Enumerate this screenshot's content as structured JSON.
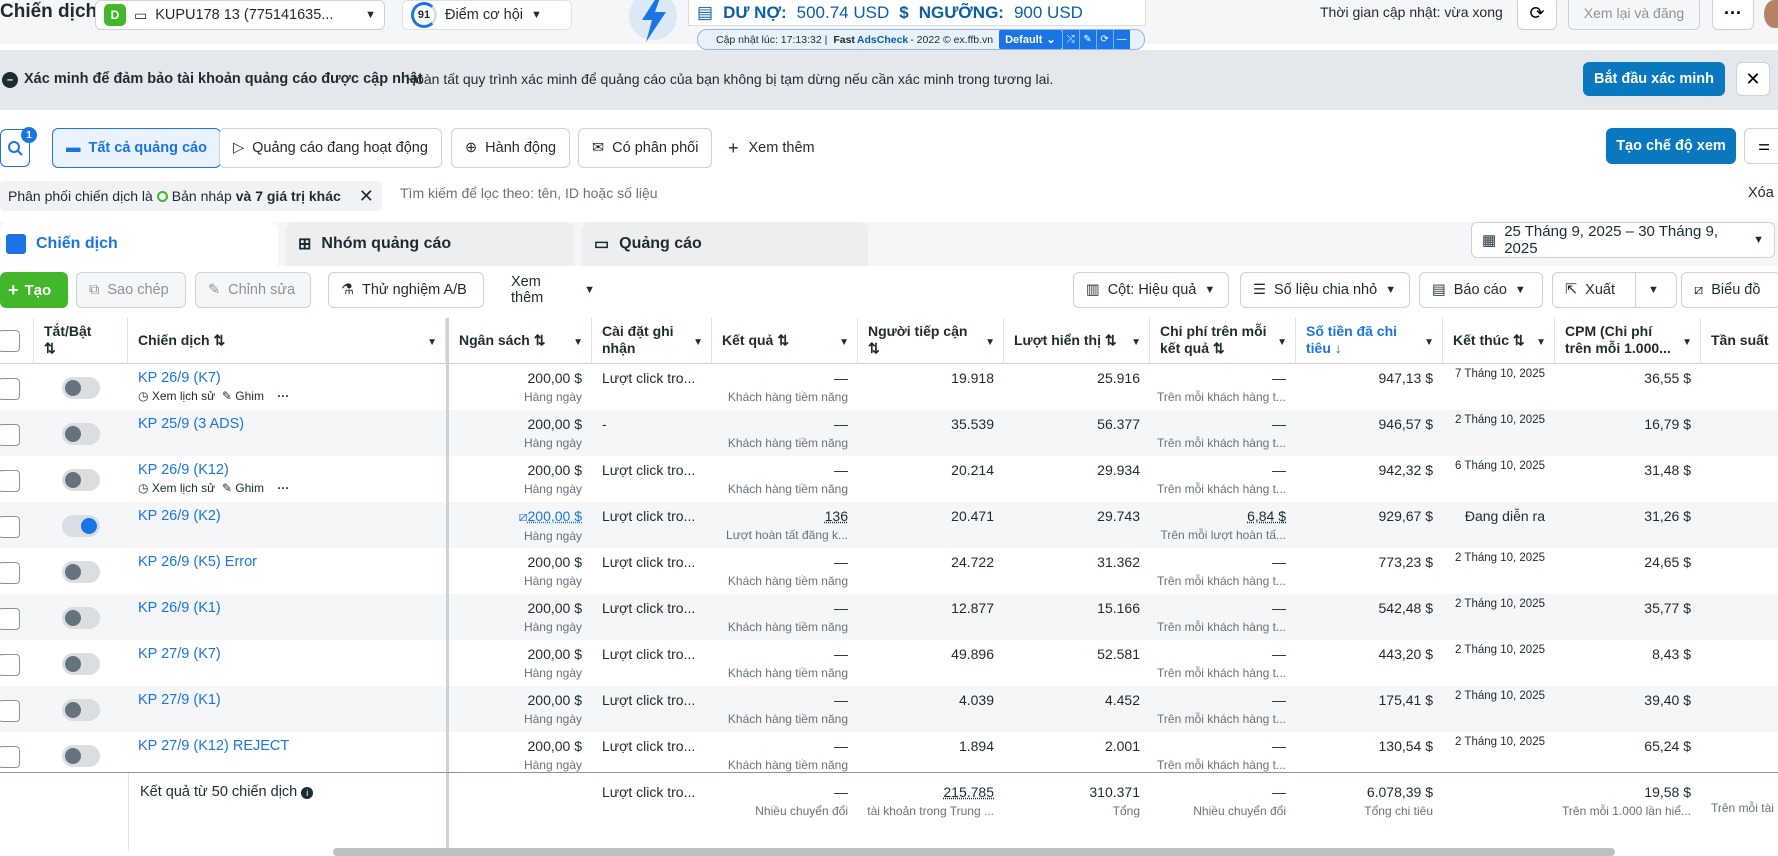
{
  "header": {
    "page_title": "Chiến dịch",
    "account_badge": "D",
    "account_name": "KUPU178 13 (775141635...",
    "opportunity_score": "91",
    "opportunity_label": "Điểm cơ hội",
    "debt_label": "DƯ NỢ:",
    "debt_value": "500.74 USD",
    "threshold_label": "NGƯỠNG:",
    "threshold_value": "900 USD",
    "update_strip": {
      "time_text": "Cập nhật lúc: 17:13:32 |",
      "fast": "Fast",
      "adscheck": "AdsCheck",
      "suffix": "- 2022 © ex.ffb.vn",
      "profile": "Default"
    },
    "update_status": "Thời gian cập nhật: vừa xong",
    "review_publish": "Xem lại và đăng",
    "more": "···"
  },
  "banner": {
    "title": "Xác minh để đảm bảo tài khoản quảng cáo được cập nhật",
    "text": "Hoàn tất quy trình xác minh để quảng cáo của bạn không bị tạm dừng nếu cần xác minh trong tương lai.",
    "verify_button": "Bắt đầu xác minh"
  },
  "filters": {
    "search_count": "1",
    "pills": [
      "Tất cả quảng cáo",
      "Quảng cáo đang hoạt động",
      "Hành động",
      "Có phân phối"
    ],
    "more": "Xem thêm",
    "create_view": "Tạo chế độ xem",
    "chip_prefix": "Phân phối chiến dịch là",
    "chip_value": "Bản nháp",
    "chip_more": "và 7 giá trị khác",
    "search_placeholder": "Tìm kiếm để lọc theo: tên, ID hoặc số liệu",
    "clear": "Xóa"
  },
  "tabs": {
    "campaigns": "Chiến dịch",
    "adsets": "Nhóm quảng cáo",
    "ads": "Quảng cáo",
    "date_range": "25 Tháng 9, 2025 – 30 Tháng 9, 2025"
  },
  "toolbar": {
    "create": "Tạo",
    "copy": "Sao chép",
    "edit": "Chỉnh sửa",
    "ab_test": "Thử nghiệm A/B",
    "more": "Xem thêm",
    "columns": "Cột: Hiệu quả",
    "breakdown": "Số liệu chia nhỏ",
    "reports": "Báo cáo",
    "export": "Xuất",
    "charts": "Biểu đồ"
  },
  "columns": {
    "toggle": "Tắt/Bật",
    "campaign": "Chiến dịch",
    "budget": "Ngân sách",
    "attribution": "Cài đặt ghi nhận",
    "results": "Kết quả",
    "reach": "Người tiếp cận",
    "impressions": "Lượt hiển thị",
    "cost_per_result": "Chi phí trên mỗi kết quả",
    "amount_spent": "Số tiền đã chi tiêu",
    "ends": "Kết thúc",
    "cpm": "CPM (Chi phí trên mỗi 1.000...",
    "frequency": "Tần suất"
  },
  "row_tools": {
    "history": "Xem lịch sử",
    "pin": "Ghim",
    "more": "···"
  },
  "rows": [
    {
      "name": "KP 26/9 (K7)",
      "on": false,
      "tools": true,
      "budget": "200,00 $",
      "budget_sub": "Hàng ngày",
      "attr": "Lượt click tro...",
      "result": "—",
      "result_sub": "Khách hàng tiềm năng",
      "reach": "19.918",
      "impr": "25.916",
      "cpr": "—",
      "cpr_sub": "Trên mỗi khách hàng t...",
      "spent": "947,13 $",
      "ends": "7 Tháng 10, 2025",
      "cpm": "36,55 $"
    },
    {
      "name": "KP 25/9 (3 ADS)",
      "on": false,
      "tools": false,
      "budget": "200,00 $",
      "budget_sub": "Hàng ngày",
      "attr": "-",
      "result": "—",
      "result_sub": "Khách hàng tiềm năng",
      "reach": "35.539",
      "impr": "56.377",
      "cpr": "—",
      "cpr_sub": "Trên mỗi khách hàng t...",
      "spent": "946,57 $",
      "ends": "2 Tháng 10, 2025",
      "cpm": "16,79 $"
    },
    {
      "name": "KP 26/9 (K12)",
      "on": false,
      "tools": true,
      "budget": "200,00 $",
      "budget_sub": "Hàng ngày",
      "attr": "Lượt click tro...",
      "result": "—",
      "result_sub": "Khách hàng tiềm năng",
      "reach": "20.214",
      "impr": "29.934",
      "cpr": "—",
      "cpr_sub": "Trên mỗi khách hàng t...",
      "spent": "942,32 $",
      "ends": "6 Tháng 10, 2025",
      "cpm": "31,48 $"
    },
    {
      "name": "KP 26/9 (K2)",
      "on": true,
      "tools": false,
      "budget": "200,00 $",
      "budget_sub": "Hàng ngày",
      "attr": "Lượt click tro...",
      "result": "136",
      "result_sub": "Lượt hoàn tất đăng k...",
      "reach": "20.471",
      "impr": "29.743",
      "cpr": "6,84 $",
      "cpr_sub": "Trên mỗi lượt hoàn tấ...",
      "spent": "929,67 $",
      "ends": "Đang diễn ra",
      "cpm": "31,26 $"
    },
    {
      "name": "KP 26/9 (K5) Error",
      "on": false,
      "tools": false,
      "budget": "200,00 $",
      "budget_sub": "Hàng ngày",
      "attr": "Lượt click tro...",
      "result": "—",
      "result_sub": "Khách hàng tiềm năng",
      "reach": "24.722",
      "impr": "31.362",
      "cpr": "—",
      "cpr_sub": "Trên mỗi khách hàng t...",
      "spent": "773,23 $",
      "ends": "2 Tháng 10, 2025",
      "cpm": "24,65 $"
    },
    {
      "name": "KP 26/9 (K1)",
      "on": false,
      "tools": false,
      "budget": "200,00 $",
      "budget_sub": "Hàng ngày",
      "attr": "Lượt click tro...",
      "result": "—",
      "result_sub": "Khách hàng tiềm năng",
      "reach": "12.877",
      "impr": "15.166",
      "cpr": "—",
      "cpr_sub": "Trên mỗi khách hàng t...",
      "spent": "542,48 $",
      "ends": "2 Tháng 10, 2025",
      "cpm": "35,77 $"
    },
    {
      "name": "KP 27/9 (K7)",
      "on": false,
      "tools": false,
      "budget": "200,00 $",
      "budget_sub": "Hàng ngày",
      "attr": "Lượt click tro...",
      "result": "—",
      "result_sub": "Khách hàng tiềm năng",
      "reach": "49.896",
      "impr": "52.581",
      "cpr": "—",
      "cpr_sub": "Trên mỗi khách hàng t...",
      "spent": "443,20 $",
      "ends": "2 Tháng 10, 2025",
      "cpm": "8,43 $"
    },
    {
      "name": "KP 27/9 (K1)",
      "on": false,
      "tools": false,
      "budget": "200,00 $",
      "budget_sub": "Hàng ngày",
      "attr": "Lượt click tro...",
      "result": "—",
      "result_sub": "Khách hàng tiềm năng",
      "reach": "4.039",
      "impr": "4.452",
      "cpr": "—",
      "cpr_sub": "Trên mỗi khách hàng t...",
      "spent": "175,41 $",
      "ends": "2 Tháng 10, 2025",
      "cpm": "39,40 $"
    },
    {
      "name": "KP 27/9 (K12) REJECT",
      "on": false,
      "tools": false,
      "budget": "200,00 $",
      "budget_sub": "Hàng ngày",
      "attr": "Lượt click tro...",
      "result": "—",
      "result_sub": "Khách hàng tiềm năng",
      "reach": "1.894",
      "impr": "2.001",
      "cpr": "—",
      "cpr_sub": "Trên mỗi khách hàng t...",
      "spent": "130,54 $",
      "ends": "2 Tháng 10, 2025",
      "cpm": "65,24 $"
    }
  ],
  "summary": {
    "label": "Kết quả từ 50 chiến dịch",
    "attr": "Lượt click tro...",
    "result": "—",
    "result_sub": "Nhiều chuyển đổi",
    "reach": "215.785",
    "reach_sub": "tài khoản trong Trung ...",
    "impr": "310.371",
    "impr_sub": "Tổng",
    "cpr": "—",
    "cpr_sub": "Nhiều chuyển đổi",
    "spent": "6.078,39 $",
    "spent_sub": "Tổng chi tiêu",
    "cpm": "19,58 $",
    "cpm_sub": "Trên mỗi 1.000 lần hiể...",
    "freq_sub": "Trên mỗi tài"
  },
  "colors": {
    "accent": "#1b74e4",
    "brand_button": "#0a78be",
    "create_green": "#42b72a",
    "banner_bg": "#e4e8ec"
  }
}
